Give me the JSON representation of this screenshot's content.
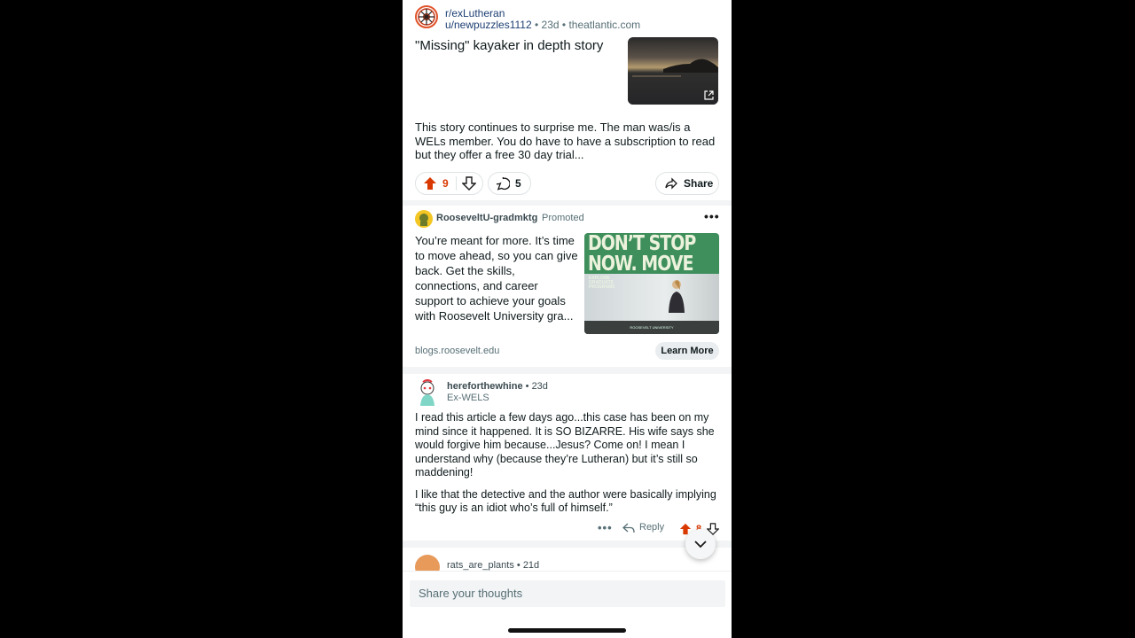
{
  "post": {
    "subreddit": "r/exLutheran",
    "author": "u/newpuzzles1112",
    "age": "23d",
    "domain": "theatlantic.com",
    "separator": "•",
    "title": "\"Missing\" kayaker in depth story",
    "body": "This story continues to surprise me. The man was/is a WELs member. You do have to have a subscription to read but they offer a free 30 day trial...",
    "upvotes": "9",
    "comments": "5",
    "share_label": "Share"
  },
  "ad": {
    "advertiser": "RooseveltU-gradmktg",
    "promoted_label": "Promoted",
    "text": "You’re meant for more. It’s time to move ahead, so you can give back. Get the skills, connections, and career support to achieve your goals with Roosevelt University gra...",
    "image_headline": "DON’T STOP NOW. MOVE UP.",
    "image_sub": "EXPLORE GRADUATE PROGRAMS",
    "image_footer": "ROOSEVELT UNIVERSITY",
    "domain": "blogs.roosevelt.edu",
    "cta": "Learn More"
  },
  "comment": {
    "user": "hereforthewhine",
    "age": "23d",
    "separator": "•",
    "flair": "Ex-WELS",
    "paragraphs": [
      "I read this article a few days ago...this case has been on my mind since it happened. It is SO BIZARRE. His wife says she would forgive him because...Jesus? Come on! I mean I understand why (because they’re Lutheran) but it’s still so maddening!",
      "I like that the detective and the author were basically implying “this guy is an idiot who’s full of himself.”"
    ],
    "reply_label": "Reply",
    "votes": "8"
  },
  "next_comment": {
    "user": "rats_are_plants",
    "age": "21d",
    "separator": "•"
  },
  "compose": {
    "placeholder": "Share your thoughts"
  },
  "colors": {
    "upvote": "#d93900",
    "ad_green": "#3f8f5c",
    "link_blue": "#1c3f73"
  }
}
